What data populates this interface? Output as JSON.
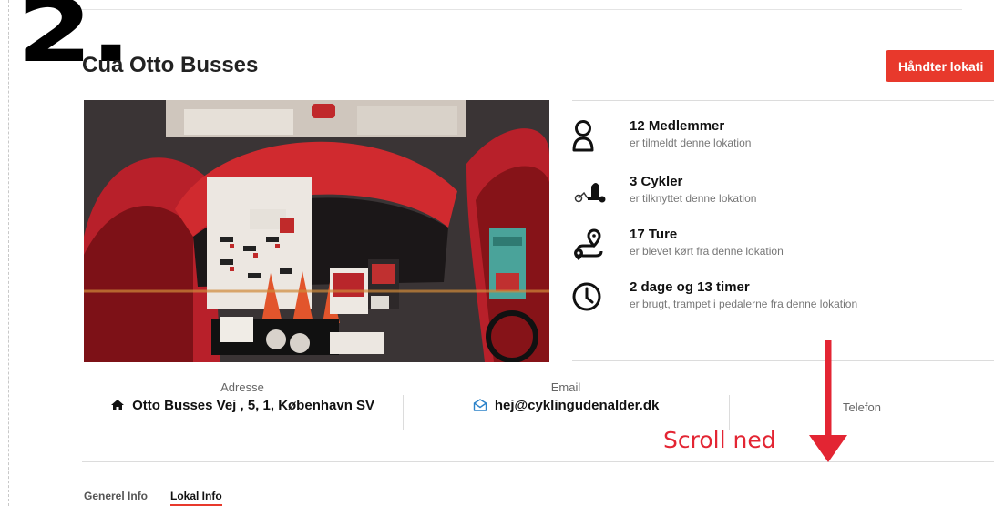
{
  "annotation": {
    "step_number": "2."
  },
  "header": {
    "title": "Cua Otto Busses",
    "manage_button": "Håndter lokati"
  },
  "stats": [
    {
      "number": "12 Medlemmer",
      "desc": "er tilmeldt denne lokation",
      "icon": "user-icon"
    },
    {
      "number": "3 Cykler",
      "desc": "er tilknyttet denne lokation",
      "icon": "rickshaw-icon"
    },
    {
      "number": "17 Ture",
      "desc": "er blevet kørt fra denne lokation",
      "icon": "route-icon"
    },
    {
      "number": "2 dage og 13 timer",
      "desc": "er brugt, trampet i pedalerne fra denne lokation",
      "icon": "clock-icon"
    }
  ],
  "info": {
    "address_label": "Adresse",
    "address_value": "Otto Busses Vej , 5, 1, København SV",
    "email_label": "Email",
    "email_value": "hej@cyklingudenalder.dk",
    "phone_label": "Telefon"
  },
  "scroll_hint": "Scroll ned",
  "tabs": [
    {
      "label": "Generel Info",
      "active": false
    },
    {
      "label": "Lokal Info",
      "active": true
    }
  ],
  "colors": {
    "accent": "#e8392c",
    "annotation_red": "#e32533"
  }
}
